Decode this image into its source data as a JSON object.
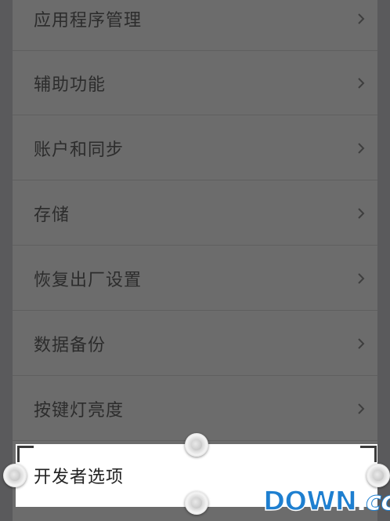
{
  "settings": {
    "items": [
      {
        "label": "应用程序管理"
      },
      {
        "label": "辅助功能"
      },
      {
        "label": "账户和同步"
      },
      {
        "label": "存储"
      },
      {
        "label": "恢复出厂设置"
      },
      {
        "label": "数据备份"
      },
      {
        "label": "按键灯亮度"
      }
    ],
    "selected_item": {
      "label": "开发者选项"
    }
  },
  "watermark": {
    "brand": "DOWN",
    "separator": ".",
    "suffix": "cc"
  },
  "colors": {
    "dim_background": "#6c6c6c",
    "highlight": "#ffffff",
    "watermark_blue": "#1e7fd0"
  },
  "icons": {
    "row_indicator": "chevron-right-icon",
    "selection_handle": "selection-handle-icon"
  }
}
